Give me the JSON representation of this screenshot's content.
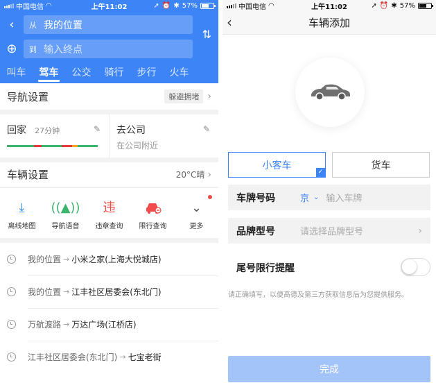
{
  "status_left": {
    "carrier": "中国电信",
    "time": "上午11:02",
    "battery": "57%"
  },
  "status_right": {
    "carrier": "中国电信",
    "time": "上午11:02",
    "battery": "57%"
  },
  "route": {
    "from_tag": "从",
    "from_value": "我的位置",
    "to_tag": "到",
    "to_placeholder": "输入终点"
  },
  "modes": [
    {
      "label": "叫车",
      "active": false
    },
    {
      "label": "驾车",
      "active": true
    },
    {
      "label": "公交",
      "active": false
    },
    {
      "label": "骑行",
      "active": false
    },
    {
      "label": "步行",
      "active": false
    },
    {
      "label": "火车",
      "active": false
    }
  ],
  "nav_settings": {
    "title": "导航设置",
    "preference": "躲避拥堵"
  },
  "favorites": {
    "home": {
      "label": "回家",
      "duration": "27分钟"
    },
    "work": {
      "label": "去公司",
      "sub": "在公司附近"
    }
  },
  "vehicle_settings": {
    "title": "车辆设置",
    "weather": "20°C晴"
  },
  "tools": [
    {
      "label": "离线地图",
      "icon": "download-icon",
      "color": "#2f8fe8"
    },
    {
      "label": "导航语音",
      "icon": "broadcast-icon",
      "color": "#3bb56b"
    },
    {
      "label": "违章查询",
      "icon": "violation-icon",
      "color": "#f24b4b"
    },
    {
      "label": "限行查询",
      "icon": "car-restrict-icon",
      "color": "#f24b4b"
    },
    {
      "label": "更多",
      "icon": "chevron-down-circle-icon",
      "color": "#555555"
    }
  ],
  "history": [
    {
      "from": "我的位置",
      "to": "小米之家(上海大悦城店)"
    },
    {
      "from": "我的位置",
      "to": "江丰社区居委会(东北门)"
    },
    {
      "from": "万航渡路",
      "to": "万达广场(江桥店)"
    },
    {
      "from": "江丰社区居委会(东北门)",
      "to": "七宝老街"
    }
  ],
  "add_vehicle": {
    "title": "车辆添加",
    "type_small": "小客车",
    "type_truck": "货车",
    "plate_label": "车牌号码",
    "plate_province": "京",
    "plate_placeholder": "输入车牌",
    "model_label": "品牌型号",
    "model_placeholder": "请选择品牌型号",
    "restrict_label": "尾号限行提醒",
    "restrict_enabled": false,
    "notice": "请正确填写，以便高德及第三方获取信息后为您提供服务。",
    "done_label": "完成"
  },
  "colors": {
    "accent": "#3d84f7",
    "done_disabled": "#a3c4f9",
    "traffic_green": "#3bb56b",
    "traffic_red": "#e63a3a",
    "traffic_yellow": "#f5a623"
  }
}
